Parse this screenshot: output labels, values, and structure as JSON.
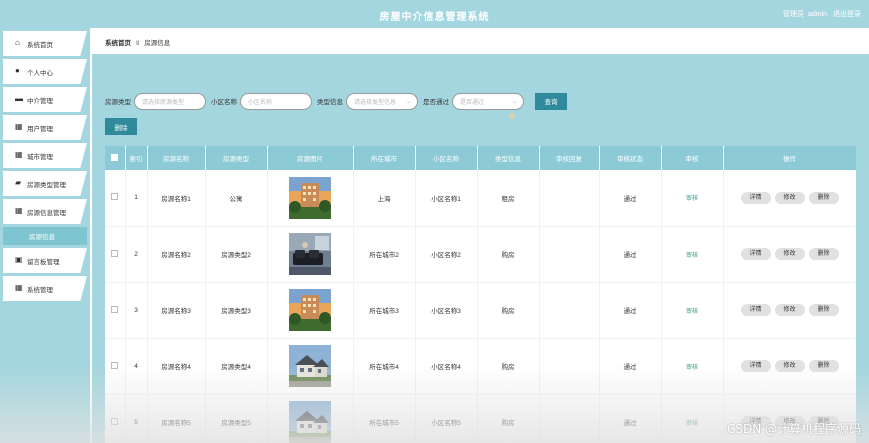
{
  "header": {
    "title": "房屋中介信息管理系统",
    "user_role": "管理员",
    "username": "admin",
    "logout": "退出登录"
  },
  "sidebar": {
    "items": [
      {
        "label": "系统首页",
        "icon": "home-icon"
      },
      {
        "label": "个人中心",
        "icon": "user-icon"
      },
      {
        "label": "中介管理",
        "icon": "message-icon"
      },
      {
        "label": "用户管理",
        "icon": "grid-icon"
      },
      {
        "label": "城市管理",
        "icon": "grid-icon"
      },
      {
        "label": "房源类型管理",
        "icon": "folder-icon"
      },
      {
        "label": "房源信息管理",
        "icon": "grid-icon"
      },
      {
        "label": "房源信息",
        "icon": ""
      },
      {
        "label": "留言板管理",
        "icon": "chat-icon"
      },
      {
        "label": "系统管理",
        "icon": "grid-icon"
      }
    ]
  },
  "breadcrumb": {
    "home": "系统首页",
    "sep": "Ⅱ",
    "current": "房源信息"
  },
  "search": {
    "type_label": "房源类型",
    "type_placeholder": "请选择房源类型",
    "community_label": "小区名称",
    "community_placeholder": "小区名称",
    "category_label": "类型信息",
    "category_placeholder": "请选择类型信息",
    "approved_label": "是否通过",
    "approved_placeholder": "是否通过",
    "search_button": "查询"
  },
  "toolbar": {
    "delete_button": "删除"
  },
  "table": {
    "headers": [
      "",
      "索引",
      "房源名称",
      "房源类型",
      "房源图片",
      "所在城市",
      "小区名称",
      "类型信息",
      "审核回复",
      "审核状态",
      "审核",
      "操作"
    ],
    "rows": [
      {
        "index": "1",
        "name": "房源名称1",
        "type": "公寓",
        "image": "house-tower",
        "city": "上海",
        "community": "小区名称1",
        "category": "租房",
        "reply": "",
        "status": "通过",
        "audit": "审核"
      },
      {
        "index": "2",
        "name": "房源名称2",
        "type": "房源类型2",
        "image": "living-room",
        "city": "所在城市2",
        "community": "小区名称2",
        "category": "购房",
        "reply": "",
        "status": "通过",
        "audit": "审核"
      },
      {
        "index": "3",
        "name": "房源名称3",
        "type": "房源类型3",
        "image": "house-tower",
        "city": "所在城市3",
        "community": "小区名称3",
        "category": "购房",
        "reply": "",
        "status": "通过",
        "audit": "审核"
      },
      {
        "index": "4",
        "name": "房源名称4",
        "type": "房源类型4",
        "image": "villa",
        "city": "所在城市4",
        "community": "小区名称4",
        "category": "购房",
        "reply": "",
        "status": "通过",
        "audit": "审核"
      },
      {
        "index": "5",
        "name": "房源名称5",
        "type": "房源类型5",
        "image": "villa",
        "city": "所在城市5",
        "community": "小区名称5",
        "category": "购房",
        "reply": "",
        "status": "通过",
        "audit": "审核"
      }
    ],
    "actions": {
      "detail": "详情",
      "edit": "修改",
      "delete": "删除"
    }
  },
  "watermark": "CSDN @计算机程序源码",
  "colors": {
    "accent": "#a4d6df",
    "header_cell": "#8ccbd6",
    "button": "#2f8b9c"
  }
}
